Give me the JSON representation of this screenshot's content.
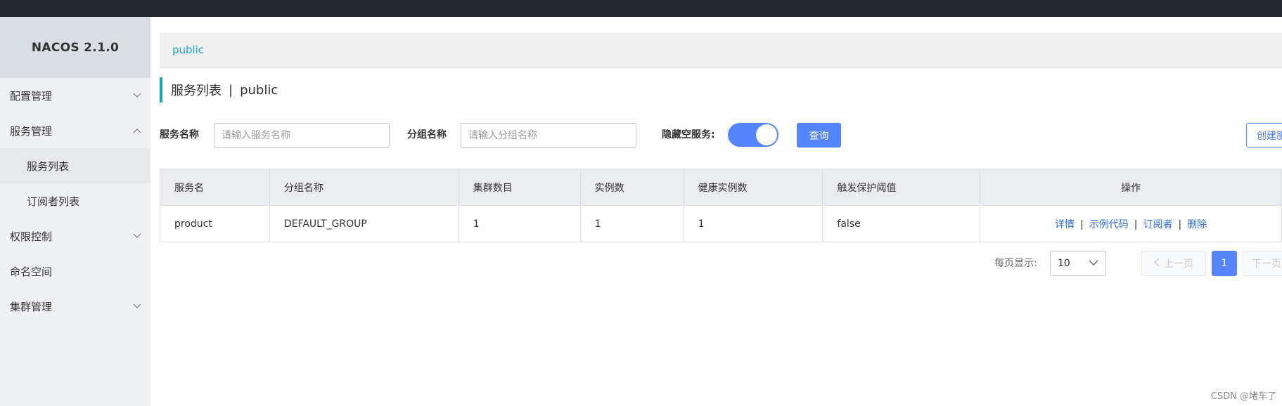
{
  "app": {
    "title": "NACOS 2.1.0"
  },
  "colors": {
    "accent": "#5584ff",
    "link": "#2d6bd6",
    "namespace": "#1fa3c9",
    "topbar": "#252a2f"
  },
  "sidebar": {
    "items": [
      {
        "label": "配置管理",
        "icon": "chevron-down-icon"
      },
      {
        "label": "服务管理",
        "icon": "chevron-up-icon"
      },
      {
        "label": "服务列表",
        "sub": true,
        "active": true
      },
      {
        "label": "订阅者列表",
        "sub": true
      },
      {
        "label": "权限控制",
        "icon": "chevron-down-icon"
      },
      {
        "label": "命名空间"
      },
      {
        "label": "集群管理",
        "icon": "chevron-down-icon"
      }
    ]
  },
  "namespace": {
    "current": "public"
  },
  "page": {
    "title": "服务列表",
    "separator": "|",
    "namespace": "public"
  },
  "filters": {
    "service_name_label": "服务名称",
    "service_name_placeholder": "请输入服务名称",
    "group_name_label": "分组名称",
    "group_name_placeholder": "请输入分组名称",
    "hide_empty_label": "隐藏空服务:",
    "hide_empty_on": true,
    "query_button": "查询",
    "create_button": "创建服务"
  },
  "table": {
    "columns": [
      "服务名",
      "分组名称",
      "集群数目",
      "实例数",
      "健康实例数",
      "触发保护阈值",
      "操作"
    ],
    "rows": [
      {
        "name": "product",
        "group": "DEFAULT_GROUP",
        "clusters": "1",
        "instances": "1",
        "healthy": "1",
        "threshold": "false"
      }
    ],
    "actions": [
      "详情",
      "示例代码",
      "订阅者",
      "删除"
    ],
    "action_separator": "|"
  },
  "pagination": {
    "page_size_label": "每页显示:",
    "page_size": "10",
    "prev": "上一页",
    "current_page": "1",
    "next": "下一页"
  },
  "watermark": "CSDN @堵车了"
}
